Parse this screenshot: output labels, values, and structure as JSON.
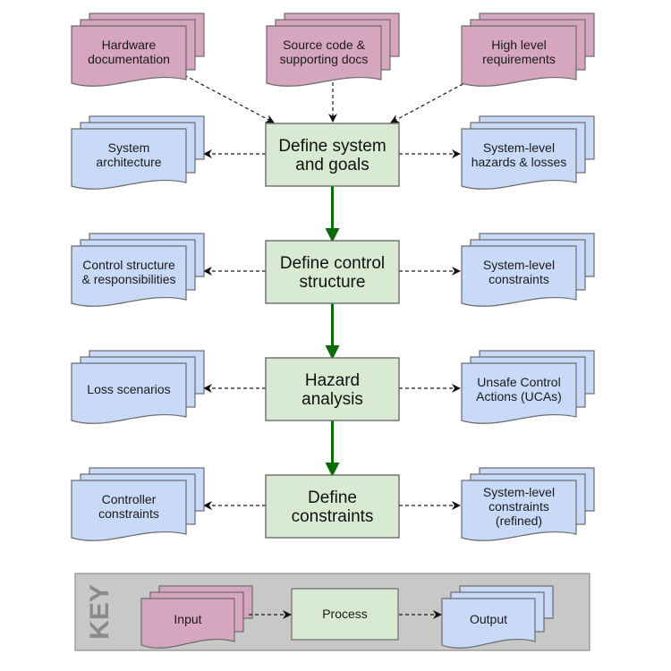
{
  "colors": {
    "input_fill": "#d6a6bf",
    "output_fill": "#c9daf8",
    "process_fill": "#d9ead3",
    "stroke": "#6b6b6b",
    "flow_arrow": "#0b6b0b",
    "dashed_arrow": "#1a1a1a",
    "key_background": "#c8c8c8"
  },
  "inputs": [
    {
      "id": "hardware-documentation",
      "lines": [
        "Hardware",
        "documentation"
      ]
    },
    {
      "id": "source-code-supporting-docs",
      "lines": [
        "Source code &",
        "supporting docs"
      ]
    },
    {
      "id": "high-level-requirements",
      "lines": [
        "High level",
        "requirements"
      ]
    }
  ],
  "processes": [
    {
      "id": "define-system-and-goals",
      "lines": [
        "Define system",
        "and goals"
      ],
      "left_output": {
        "id": "system-architecture",
        "lines": [
          "System",
          "architecture"
        ]
      },
      "right_output": {
        "id": "system-level-hazards-losses",
        "lines": [
          "System-level",
          "hazards & losses"
        ]
      }
    },
    {
      "id": "define-control-structure",
      "lines": [
        "Define control",
        "structure"
      ],
      "left_output": {
        "id": "control-structure-responsibilities",
        "lines": [
          "Control structure",
          "& responsibilities"
        ]
      },
      "right_output": {
        "id": "system-level-constraints",
        "lines": [
          "System-level",
          "constraints"
        ]
      }
    },
    {
      "id": "hazard-analysis",
      "lines": [
        "Hazard",
        "analysis"
      ],
      "left_output": {
        "id": "loss-scenarios",
        "lines": [
          "Loss scenarios"
        ]
      },
      "right_output": {
        "id": "unsafe-control-actions",
        "lines": [
          "Unsafe Control",
          "Actions (UCAs)"
        ]
      }
    },
    {
      "id": "define-constraints",
      "lines": [
        "Define",
        "constraints"
      ],
      "left_output": {
        "id": "controller-constraints",
        "lines": [
          "Controller",
          "constraints"
        ]
      },
      "right_output": {
        "id": "system-level-constraints-refined",
        "lines": [
          "System-level",
          "constraints",
          "(refined)"
        ]
      }
    }
  ],
  "key": {
    "title": "KEY",
    "input_label": "Input",
    "process_label": "Process",
    "output_label": "Output"
  }
}
